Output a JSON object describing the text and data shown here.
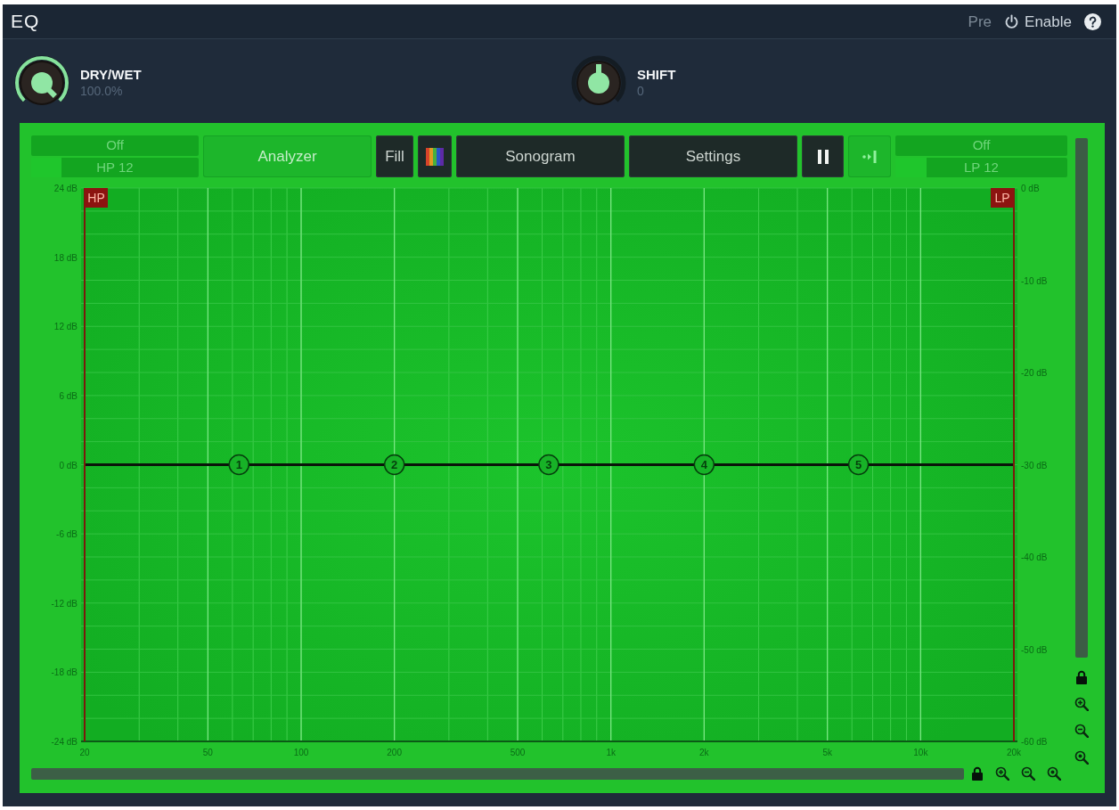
{
  "header": {
    "title": "EQ",
    "pre": {
      "label": "Pre",
      "on": false
    },
    "enable": {
      "label": "Enable",
      "on": true
    }
  },
  "knobs": [
    {
      "label": "DRY/WET",
      "value": "100.0%",
      "kind": "unipolar",
      "level": 1
    },
    {
      "label": "SHIFT",
      "value": "0",
      "kind": "bipolar",
      "level": 0.5
    }
  ],
  "toolbar": {
    "hp_filter": {
      "frequency": "Off",
      "slope": {
        "text": "HP 12",
        "level": 0.18
      }
    },
    "buttons": [
      {
        "kind": "text",
        "label": "Analyzer",
        "on": true
      },
      {
        "kind": "text",
        "label": "Fill",
        "on": false
      },
      {
        "kind": "palette",
        "on": false
      },
      {
        "kind": "text",
        "label": "Sonogram",
        "on": false
      },
      {
        "kind": "text",
        "label": "Settings",
        "on": false
      },
      {
        "kind": "pause",
        "on": false
      },
      {
        "kind": "snap",
        "on": true
      }
    ],
    "lp_filter": {
      "frequency": "Off",
      "slope": {
        "text": "LP 12",
        "level": 0.18
      }
    }
  },
  "display": {
    "chart_data": {
      "type": "line",
      "log": "x",
      "grid": true,
      "xlim": [
        20,
        20000
      ],
      "ylim": [
        -24,
        24
      ],
      "y2lim": [
        -60,
        0
      ],
      "xticks": [
        {
          "value": 20,
          "label": "20"
        },
        {
          "value": 50,
          "label": "50"
        },
        {
          "value": 100,
          "label": "100"
        },
        {
          "value": 200,
          "label": "200"
        },
        {
          "value": 500,
          "label": "500"
        },
        {
          "value": 1000,
          "label": "1k"
        },
        {
          "value": 2000,
          "label": "2k"
        },
        {
          "value": 5000,
          "label": "5k"
        },
        {
          "value": 10000,
          "label": "10k"
        },
        {
          "value": 20000,
          "label": "20k"
        }
      ],
      "yticks": [
        {
          "value": 24,
          "label": "24 dB"
        },
        {
          "value": 18,
          "label": "18 dB"
        },
        {
          "value": 12,
          "label": "12 dB"
        },
        {
          "value": 6,
          "label": "6 dB"
        },
        {
          "value": 0,
          "label": "0 dB"
        },
        {
          "value": -6,
          "label": "-6 dB"
        },
        {
          "value": -12,
          "label": "-12 dB"
        },
        {
          "value": -18,
          "label": "-18 dB"
        },
        {
          "value": -24,
          "label": "-24 dB"
        }
      ],
      "y2ticks": [
        {
          "value": 0,
          "label": "0 dB"
        },
        {
          "value": -10,
          "label": "-10 dB"
        },
        {
          "value": -20,
          "label": "-20 dB"
        },
        {
          "value": -30,
          "label": "-30 dB"
        },
        {
          "value": -40,
          "label": "-40 dB"
        },
        {
          "value": -50,
          "label": "-50 dB"
        },
        {
          "value": -60,
          "label": "-60 dB"
        }
      ],
      "series": [
        {
          "type": "line",
          "x": [
            20,
            20000
          ],
          "values": [
            0,
            0
          ],
          "color": "#0a140a"
        },
        {
          "type": "scatter",
          "name": "1",
          "x": [
            63
          ],
          "values": [
            0
          ],
          "color": "#063f0d"
        },
        {
          "type": "scatter",
          "name": "2",
          "x": [
            200
          ],
          "values": [
            0
          ],
          "color": "#063f0d"
        },
        {
          "type": "scatter",
          "name": "3",
          "x": [
            630
          ],
          "values": [
            0
          ],
          "color": "#063f0d"
        },
        {
          "type": "scatter",
          "name": "4",
          "x": [
            2000
          ],
          "values": [
            0
          ],
          "color": "#063f0d"
        },
        {
          "type": "scatter",
          "name": "5",
          "x": [
            6300
          ],
          "values": [
            0
          ],
          "color": "#063f0d"
        }
      ],
      "ref_lines": [
        {
          "axis": "x",
          "value": 20,
          "label": "HP",
          "color": "#7a1a0c"
        },
        {
          "axis": "x",
          "value": 20000,
          "label": "LP",
          "color": "#7a1a0c"
        }
      ]
    }
  }
}
